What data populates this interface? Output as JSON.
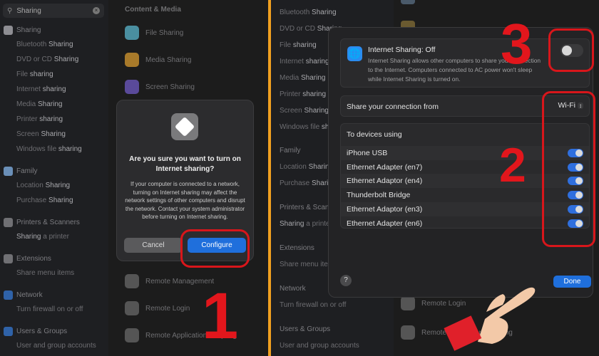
{
  "left_panel": {
    "search": {
      "value": "Sharing",
      "placeholder": ""
    },
    "sidebar": [
      {
        "type": "cat",
        "label": "Sharing",
        "color": "#8e8e93"
      },
      {
        "type": "item",
        "pre": "Bluetooth ",
        "hl": "Sharing"
      },
      {
        "type": "item",
        "pre": "DVD or CD ",
        "hl": "Sharing"
      },
      {
        "type": "item",
        "pre": "File ",
        "hl": "sharing"
      },
      {
        "type": "item",
        "pre": "Internet ",
        "hl": "sharing"
      },
      {
        "type": "item",
        "pre": "Media ",
        "hl": "Sharing"
      },
      {
        "type": "item",
        "pre": "Printer ",
        "hl": "sharing"
      },
      {
        "type": "item",
        "pre": "Screen ",
        "hl": "Sharing"
      },
      {
        "type": "item",
        "pre": "Windows file ",
        "hl": "sharing"
      },
      {
        "type": "cat",
        "label": "Family",
        "color": "#6a8fb8"
      },
      {
        "type": "item",
        "pre": "Location ",
        "hl": "Sharing"
      },
      {
        "type": "item",
        "pre": "Purchase ",
        "hl": "Sharing"
      },
      {
        "type": "cat",
        "label": "Printers & Scanners",
        "color": "#707074"
      },
      {
        "type": "item",
        "pre": "",
        "hl": "Sharing",
        "post": " a printer"
      },
      {
        "type": "cat",
        "label": "Extensions",
        "color": "#707074"
      },
      {
        "type": "item",
        "pre": "Share menu items",
        "hl": ""
      },
      {
        "type": "cat",
        "label": "Network",
        "color": "#2f62a8"
      },
      {
        "type": "item",
        "pre": "Turn firewall on or off",
        "hl": ""
      },
      {
        "type": "cat",
        "label": "Users & Groups",
        "color": "#2f62a8"
      },
      {
        "type": "item",
        "pre": "User and group accounts",
        "hl": ""
      }
    ],
    "section_title": "Content & Media",
    "content_items": [
      {
        "label": "File Sharing",
        "color": "#4a8fa0"
      },
      {
        "label": "Media Sharing",
        "color": "#a87a2a"
      },
      {
        "label": "Screen Sharing",
        "color": "#5a4a9a"
      }
    ],
    "bottom_items": [
      {
        "label": "Remote Management",
        "color": "#555"
      },
      {
        "label": "Remote Login",
        "color": "#555"
      },
      {
        "label": "Remote Application Scripting",
        "color": "#555"
      }
    ],
    "alert": {
      "icon": "internet-sharing-icon",
      "title": "Are you sure you want to turn on Internet sharing?",
      "message": "If your computer is connected to a network, turning on Internet sharing may affect the network settings of other computers and disrupt the network. Contact your system administrator before turning on Internet sharing.",
      "cancel": "Cancel",
      "configure": "Configure"
    }
  },
  "right_panel": {
    "sidebar": [
      {
        "pre": "Bluetooth ",
        "hl": "Sharing"
      },
      {
        "pre": "DVD or CD ",
        "hl": "Sharing"
      },
      {
        "pre": "File ",
        "hl": "sharing"
      },
      {
        "pre": "Internet ",
        "hl": "sharing"
      },
      {
        "pre": "Media ",
        "hl": "Sharing"
      },
      {
        "pre": "Printer ",
        "hl": "sharing"
      },
      {
        "pre": "Screen ",
        "hl": "Sharing"
      },
      {
        "pre": "Windows file ",
        "hl": "sharing"
      }
    ],
    "sidebar_lower": [
      {
        "type": "cat",
        "label": "Family"
      },
      {
        "type": "item",
        "pre": "Location ",
        "hl": "Sharing"
      },
      {
        "type": "item",
        "pre": "Purchase ",
        "hl": "Sharing"
      },
      {
        "type": "cat",
        "label": "Printers & Scanners"
      },
      {
        "type": "item",
        "pre": "",
        "hl": "Sharing",
        "post": " a printer"
      },
      {
        "type": "cat",
        "label": "Extensions"
      },
      {
        "type": "item",
        "pre": "Share menu items",
        "hl": ""
      },
      {
        "type": "cat",
        "label": "Network"
      },
      {
        "type": "item",
        "pre": "Turn firewall on or off",
        "hl": ""
      },
      {
        "type": "cat",
        "label": "Users & Groups"
      },
      {
        "type": "item",
        "pre": "User and group accounts",
        "hl": ""
      }
    ],
    "bg_items": [
      "Remote Login",
      "Remote Application Scripting"
    ],
    "dialog": {
      "title": "Internet Sharing: Off",
      "description": "Internet Sharing allows other computers to share your connection to the Internet. Computers connected to AC power won't sleep while Internet Sharing is turned on.",
      "main_toggle_on": false,
      "share_from_label": "Share your connection from",
      "share_from_value": "Wi-Fi",
      "devices_header": "To devices using",
      "devices": [
        {
          "name": "iPhone USB",
          "on": true
        },
        {
          "name": "Ethernet Adapter (en7)",
          "on": true
        },
        {
          "name": "Ethernet Adaptor (en4)",
          "on": true
        },
        {
          "name": "Thunderbolt Bridge",
          "on": true
        },
        {
          "name": "Ethernet Adaptor (en3)",
          "on": true
        },
        {
          "name": "Ethernet Adapter (en6)",
          "on": true
        }
      ],
      "help": "?",
      "done": "Done"
    }
  },
  "annotations": {
    "step1": "1",
    "step2": "2",
    "step3": "3",
    "color": "#e2161c",
    "divider_color": "#f0a020",
    "accent": "#2f6fde"
  }
}
